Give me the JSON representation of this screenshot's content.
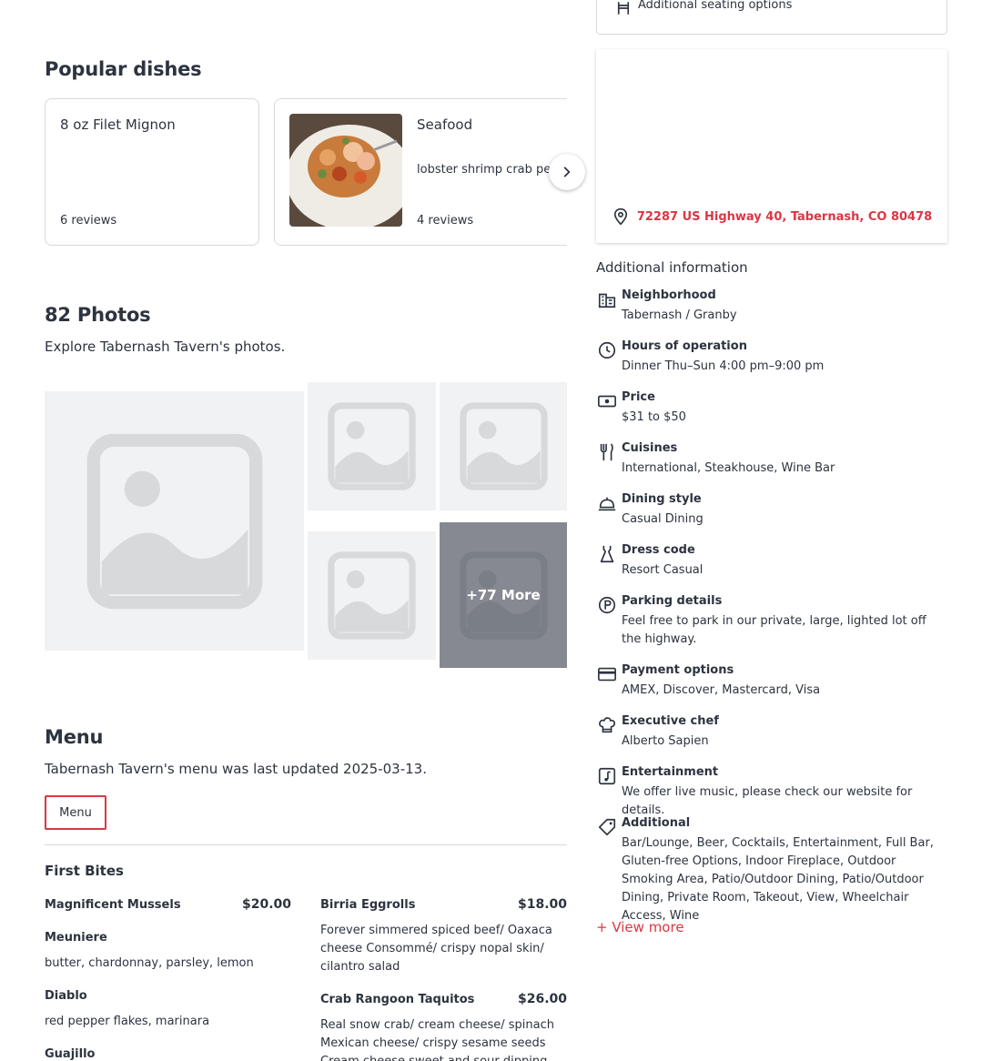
{
  "seating": {
    "label": "Additional seating options",
    "icon": "chair-icon"
  },
  "popular": {
    "title": "Popular dishes",
    "dishes": [
      {
        "name": "8 oz Filet Mignon",
        "description": "",
        "reviews": "6 reviews"
      },
      {
        "name": "Seafood",
        "description": "lobster shrimp crab peas",
        "reviews": "4 reviews"
      }
    ]
  },
  "photos": {
    "title": "82 Photos",
    "subtitle": "Explore Tabernash Tavern's photos.",
    "more_label": "+77 More"
  },
  "menu": {
    "title": "Menu",
    "subtitle": "Tabernash Tavern's menu was last updated 2025-03-13.",
    "tab_label": "Menu",
    "section": "First Bites",
    "left_items": [
      {
        "name": "Magnificent Mussels",
        "price": "$20.00"
      },
      {
        "name": "Meuniere",
        "desc": "butter, chardonnay, parsley, lemon"
      },
      {
        "name": "Diablo",
        "desc": "red pepper flakes, marinara"
      },
      {
        "name": "Guajillo"
      }
    ],
    "right_items": [
      {
        "name": "Birria Eggrolls",
        "price": "$18.00",
        "desc": "Forever simmered spiced beef/ Oaxaca cheese Consommé/ crispy nopal skin/ cilantro salad"
      },
      {
        "name": "Crab Rangoon Taquitos",
        "price": "$26.00",
        "desc": "Real snow crab/ cream cheese/ spinach Mexican cheese/ crispy sesame seeds Cream cheese sweet and sour dipping sauce"
      }
    ]
  },
  "map": {
    "address": "72287 US Highway 40, Tabernash, CO 80478"
  },
  "additional": {
    "title": "Additional information",
    "items": [
      {
        "label": "Neighborhood",
        "value": "Tabernash / Granby",
        "icon": "building-icon"
      },
      {
        "label": "Hours of operation",
        "value": "Dinner Thu–Sun 4:00 pm–9:00 pm",
        "icon": "clock-icon"
      },
      {
        "label": "Price",
        "value": "$31 to $50",
        "icon": "money-icon"
      },
      {
        "label": "Cuisines",
        "value": "International, Steakhouse, Wine Bar",
        "icon": "fork-knife-icon"
      },
      {
        "label": "Dining style",
        "value": "Casual Dining",
        "icon": "cloche-icon"
      },
      {
        "label": "Dress code",
        "value": "Resort Casual",
        "icon": "dress-icon"
      },
      {
        "label": "Parking details",
        "value": "Feel free to park in our private, large, lighted lot off the highway.",
        "icon": "parking-icon"
      },
      {
        "label": "Payment options",
        "value": "AMEX, Discover, Mastercard, Visa",
        "icon": "credit-card-icon"
      },
      {
        "label": "Executive chef",
        "value": "Alberto Sapien",
        "icon": "chef-hat-icon"
      },
      {
        "label": "Entertainment",
        "value": "We offer live music, please check our website for details.",
        "icon": "music-note-icon"
      },
      {
        "label": "Additional",
        "value": "Bar/Lounge, Beer, Cocktails, Entertainment, Full Bar, Gluten-free Options, Indoor Fireplace, Outdoor Smoking Area, Patio/Outdoor Dining, Patio/Outdoor Dining, Private Room, Takeout, View, Wheelchair Access, Wine",
        "icon": "tag-icon"
      }
    ],
    "view_more": "+ View more"
  },
  "colors": {
    "accent": "#da3743",
    "text": "#2d333f",
    "border": "#d8d9db",
    "placeholder": "#f1f2f4"
  }
}
